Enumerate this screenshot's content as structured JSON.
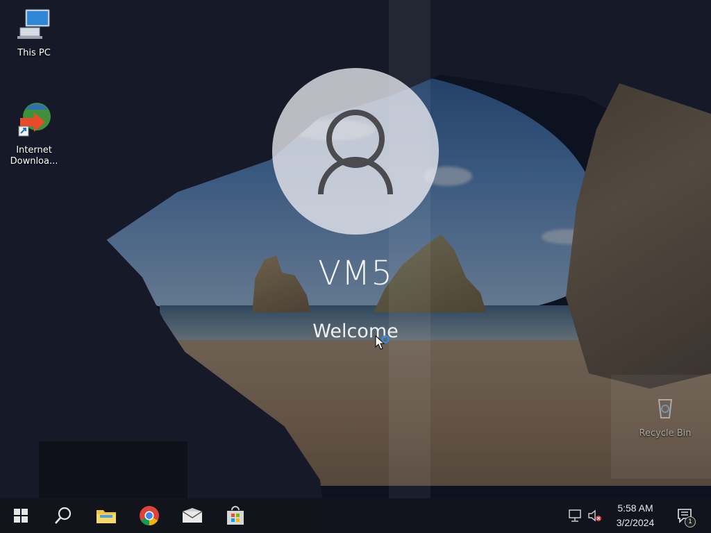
{
  "login": {
    "user_name": "VM5",
    "status": "Welcome"
  },
  "desktop": {
    "icons": [
      {
        "label": "This PC",
        "icon": "this-pc-icon"
      },
      {
        "label": "Internet Downloa...",
        "icon": "internet-download-manager-icon"
      },
      {
        "label": "Recycle Bin",
        "icon": "recycle-bin-icon"
      }
    ]
  },
  "taskbar": {
    "items": [
      "start-button",
      "search-button",
      "file-explorer-button",
      "chrome-button",
      "mail-button",
      "store-button"
    ],
    "clock": {
      "time": "5:58 AM",
      "date": "3/2/2024"
    },
    "notification_count": "1",
    "tray": [
      "network-icon",
      "volume-muted-icon"
    ]
  },
  "colors": {
    "taskbar": "#12141c",
    "avatar_bg": "#ebebf0",
    "text": "#ffffff"
  }
}
